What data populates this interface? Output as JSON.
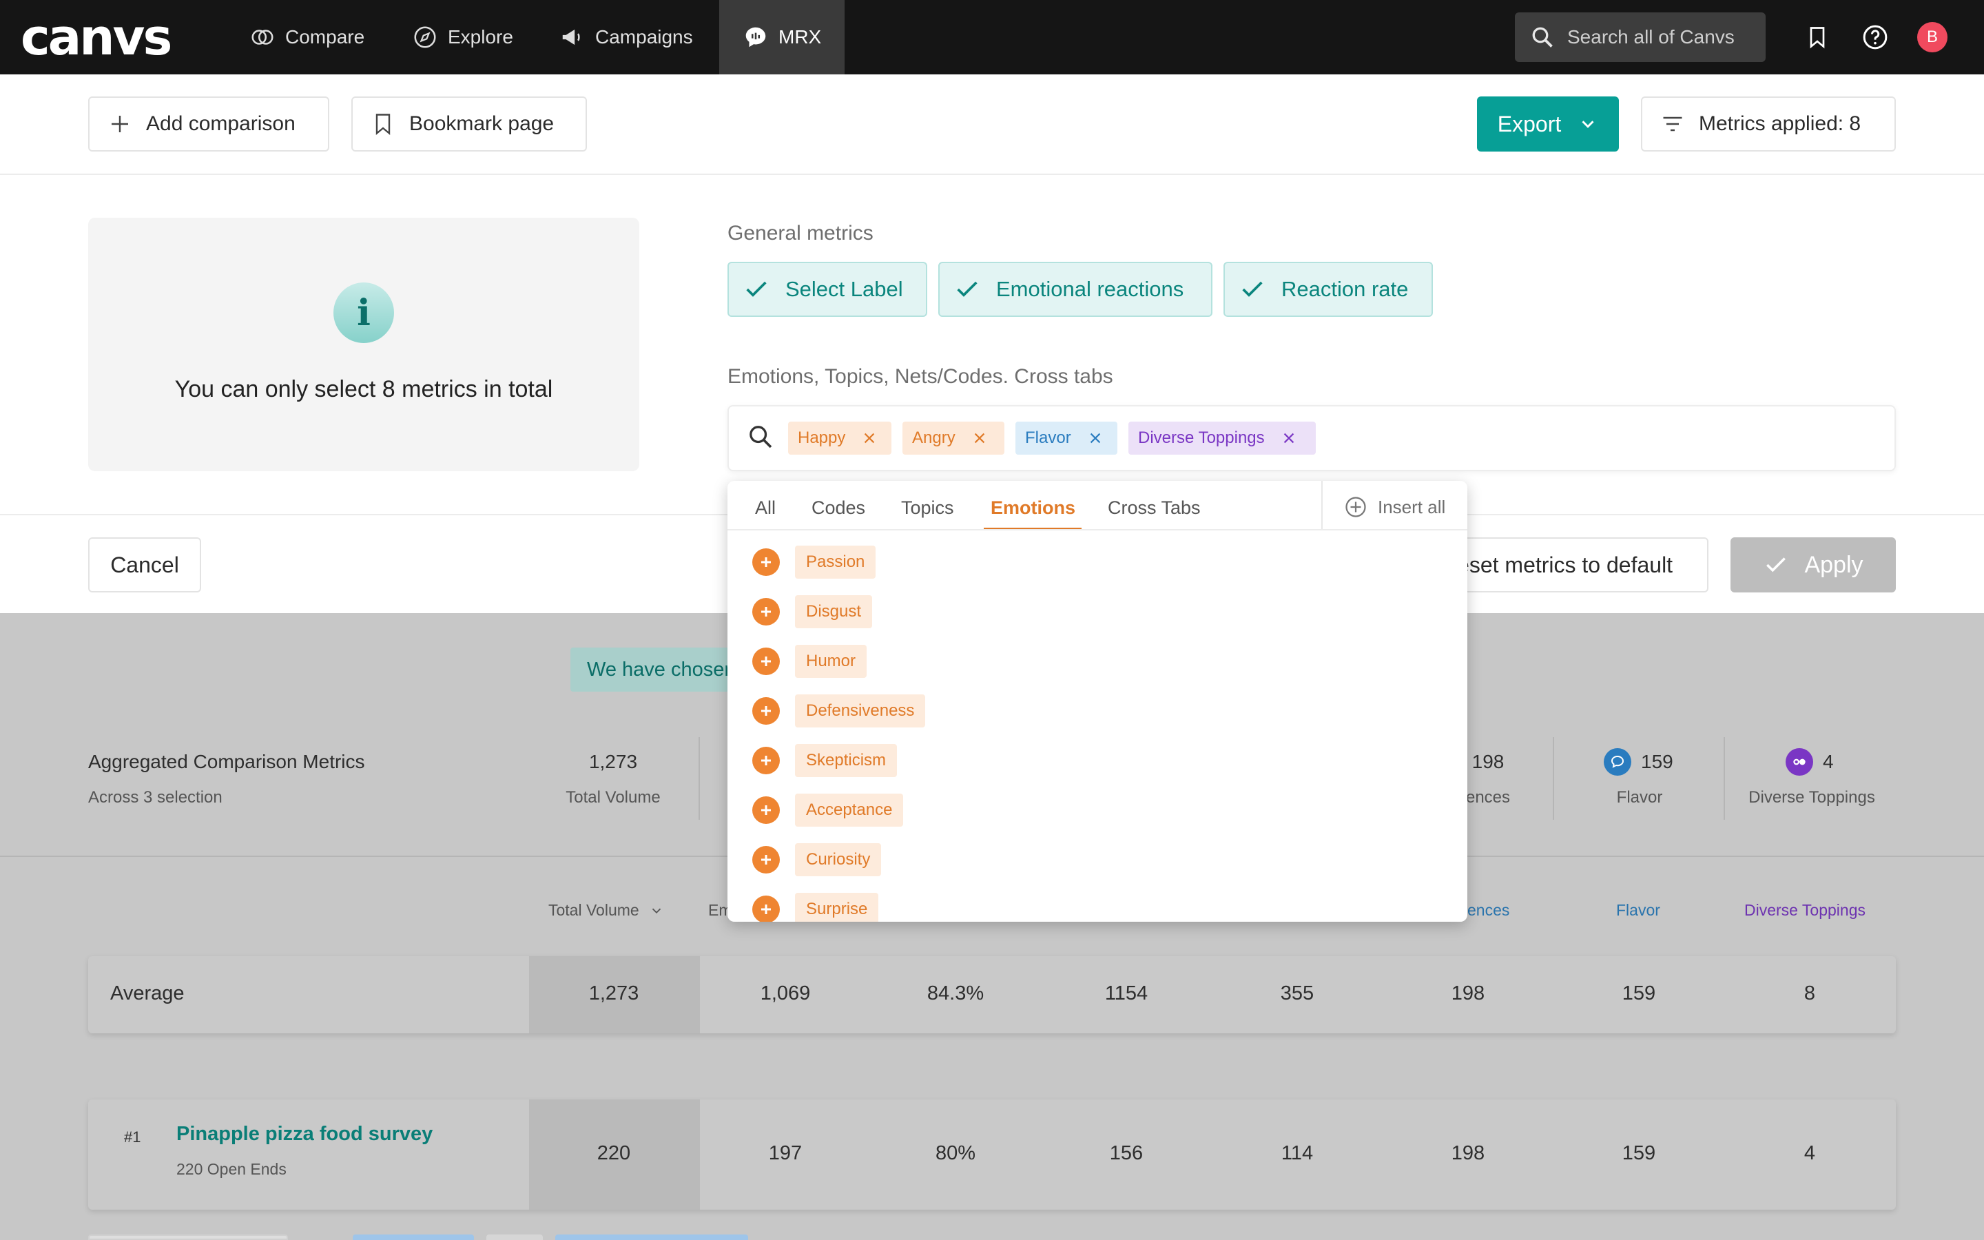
{
  "nav": {
    "logo": "canvs",
    "items": [
      {
        "label": "Compare",
        "icon": "compare-icon"
      },
      {
        "label": "Explore",
        "icon": "compass-icon"
      },
      {
        "label": "Campaigns",
        "icon": "megaphone-icon"
      },
      {
        "label": "MRX",
        "icon": "chat-bubble-icon"
      }
    ],
    "active": "MRX",
    "search_placeholder": "Search all of Canvs",
    "avatar_initial": "B"
  },
  "toolbar": {
    "add_comparison": "Add comparison",
    "bookmark_page": "Bookmark page",
    "export": "Export",
    "metrics_applied": "Metrics applied: 8"
  },
  "info_box": {
    "icon": "info-icon",
    "message": "You can only select 8 metrics in total"
  },
  "general_metrics": {
    "label": "General metrics",
    "chips": [
      "Select Label",
      "Emotional reactions",
      "Reaction rate"
    ]
  },
  "cross_tabs": {
    "label": "Emotions, Topics, Nets/Codes. Cross tabs",
    "tags": [
      {
        "label": "Happy",
        "kind": "emotion"
      },
      {
        "label": "Angry",
        "kind": "emotion"
      },
      {
        "label": "Flavor",
        "kind": "topic"
      },
      {
        "label": "Diverse Toppings",
        "kind": "code"
      }
    ]
  },
  "dropdown": {
    "tabs": [
      "All",
      "Codes",
      "Topics",
      "Emotions",
      "Cross Tabs"
    ],
    "active_tab": "Emotions",
    "insert_all": "Insert all",
    "emotions": [
      "Passion",
      "Disgust",
      "Humor",
      "Defensiveness",
      "Skepticism",
      "Acceptance",
      "Curiosity",
      "Surprise"
    ]
  },
  "actions": {
    "cancel": "Cancel",
    "reset": "Reset metrics to default",
    "apply": "Apply"
  },
  "background": {
    "banner": "We have chosen",
    "aggregate": {
      "title": "Aggregated Comparison Metrics",
      "subtitle": "Across 3 selection",
      "total_volume": "1,273",
      "total_volume_label": "Total Volume",
      "sentences_value": "198",
      "sentences_label": "ences",
      "flavor_value": "159",
      "flavor_label": "Flavor",
      "toppings_value": "4",
      "toppings_label": "Diverse Toppings"
    },
    "columns": {
      "total_volume": "Total Volume",
      "em": "Em",
      "sentences": "ences",
      "flavor": "Flavor",
      "toppings": "Diverse Toppings"
    },
    "average_row": {
      "label": "Average",
      "values": [
        "1,273",
        "1,069",
        "84.3%",
        "1154",
        "355",
        "198",
        "159",
        "8"
      ]
    },
    "survey_row": {
      "rank": "#1",
      "name": "Pinapple pizza food survey",
      "subtitle": "220 Open Ends",
      "values": [
        "220",
        "197",
        "80%",
        "156",
        "114",
        "198",
        "159",
        "4"
      ]
    }
  },
  "colors": {
    "accent": "#079f96",
    "emotion": "#e07a28",
    "topic": "#2a7cbf",
    "code": "#7a36c4",
    "avatar": "#f04a5e"
  }
}
